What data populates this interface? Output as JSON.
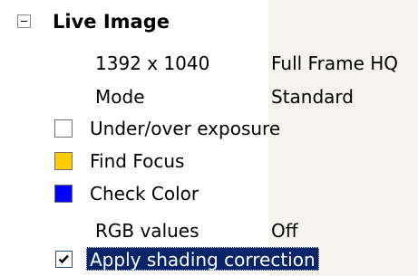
{
  "section": {
    "title": "Live Image",
    "expander_icon": "minus-box-icon"
  },
  "properties": [
    {
      "label": "1392 x 1040",
      "value": "Full Frame HQ"
    },
    {
      "label": "Mode",
      "value": "Standard"
    }
  ],
  "options": {
    "under_over_exposure": {
      "label": "Under/over exposure",
      "color": "#ffffff"
    },
    "find_focus": {
      "label": "Find Focus",
      "color": "#ffcc00"
    },
    "check_color": {
      "label": "Check Color",
      "color": "#0000ff"
    }
  },
  "rgb": {
    "label": "RGB values",
    "value": "Off"
  },
  "shading": {
    "label": "Apply shading correction",
    "checked": true,
    "selected_color": "#0a246a"
  }
}
